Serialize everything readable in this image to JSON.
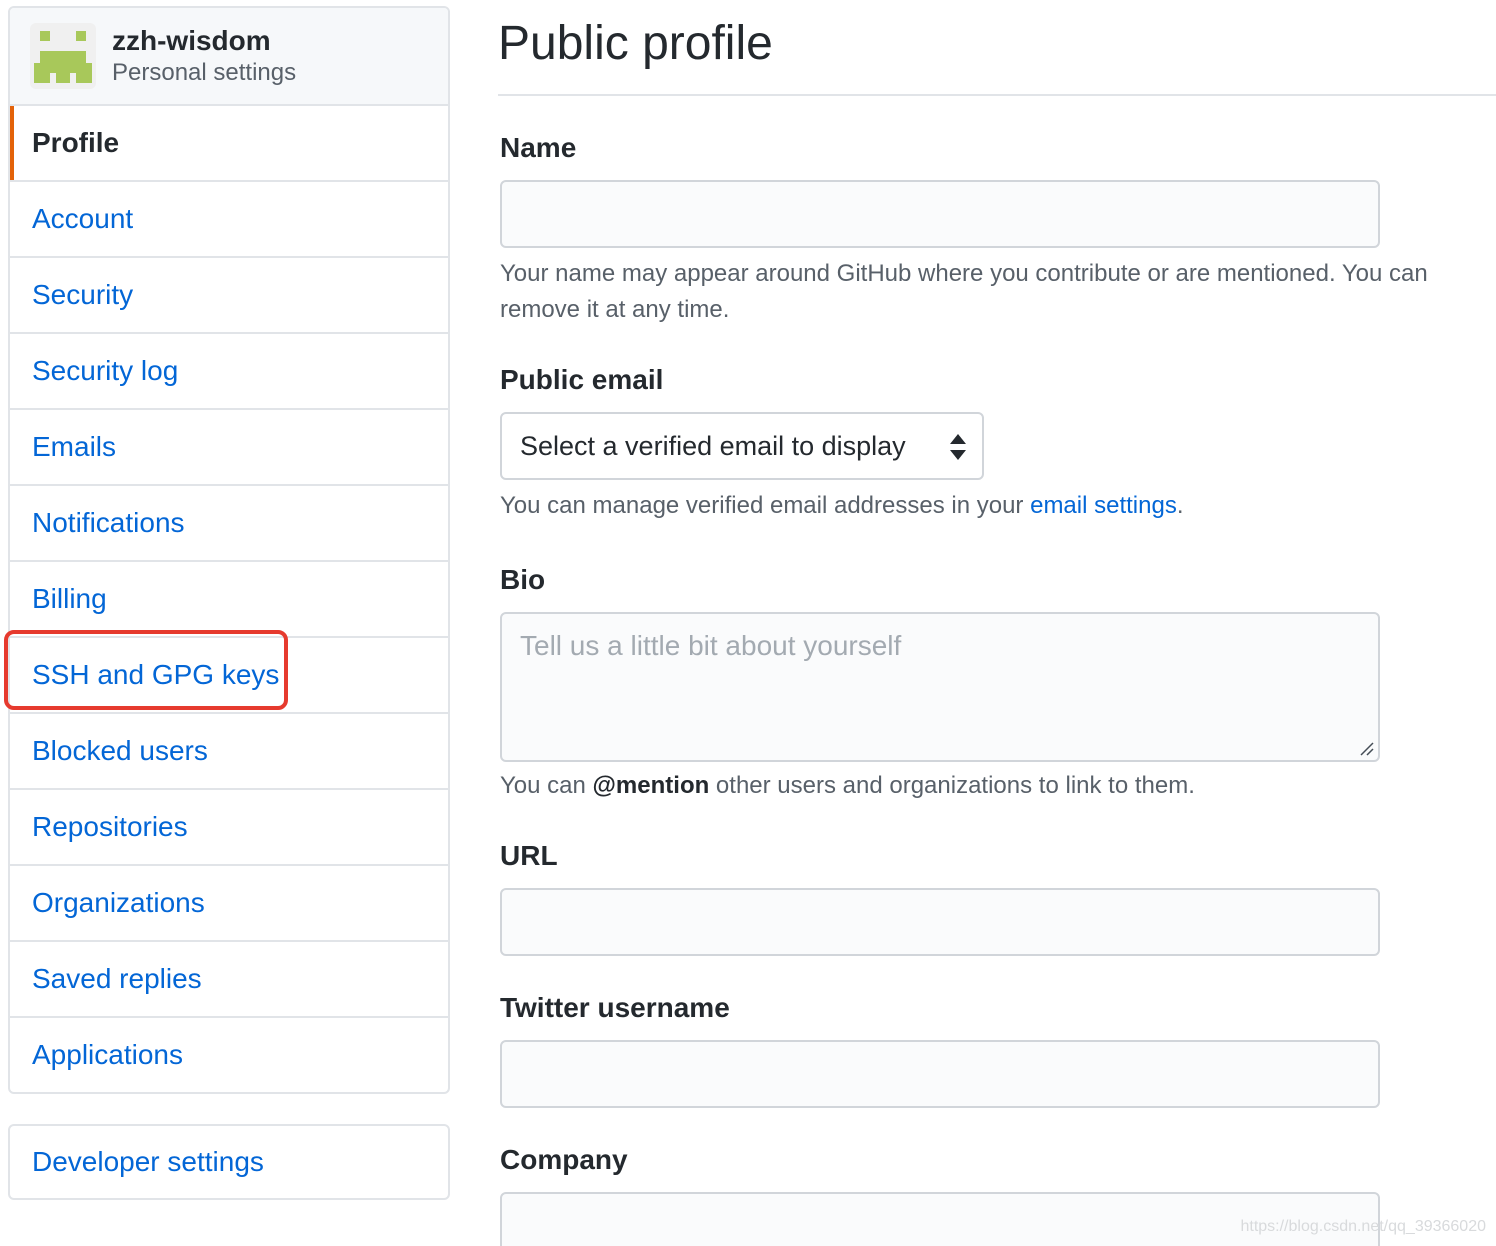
{
  "sidebar": {
    "username": "zzh-wisdom",
    "subtitle": "Personal settings",
    "items": [
      {
        "label": "Profile"
      },
      {
        "label": "Account"
      },
      {
        "label": "Security"
      },
      {
        "label": "Security log"
      },
      {
        "label": "Emails"
      },
      {
        "label": "Notifications"
      },
      {
        "label": "Billing"
      },
      {
        "label": "SSH and GPG keys"
      },
      {
        "label": "Blocked users"
      },
      {
        "label": "Repositories"
      },
      {
        "label": "Organizations"
      },
      {
        "label": "Saved replies"
      },
      {
        "label": "Applications"
      }
    ],
    "developer_settings": "Developer settings",
    "selected_item": "Profile",
    "highlighted_item": "SSH and GPG keys"
  },
  "main": {
    "title": "Public profile",
    "name": {
      "label": "Name",
      "value": "",
      "note": "Your name may appear around GitHub where you contribute or are mentioned. You can remove it at any time."
    },
    "public_email": {
      "label": "Public email",
      "selected": "Select a verified email to display",
      "note_prefix": "You can manage verified email addresses in your ",
      "note_link": "email settings",
      "note_suffix": "."
    },
    "bio": {
      "label": "Bio",
      "placeholder": "Tell us a little bit about yourself",
      "note_prefix": "You can ",
      "note_bold": "@mention",
      "note_suffix": " other users and organizations to link to them."
    },
    "url": {
      "label": "URL",
      "value": ""
    },
    "twitter": {
      "label": "Twitter username",
      "value": ""
    },
    "company": {
      "label": "Company",
      "value": ""
    }
  },
  "watermark": "https://blog.csdn.net/qq_39366020",
  "colors": {
    "link": "#0366d6",
    "selected_accent": "#e36209",
    "highlight_box": "#e63a2e",
    "avatar_green": "#a8c85a"
  },
  "icons": [
    "identicon-avatar",
    "select-arrows-icon",
    "resize-handle-icon"
  ]
}
